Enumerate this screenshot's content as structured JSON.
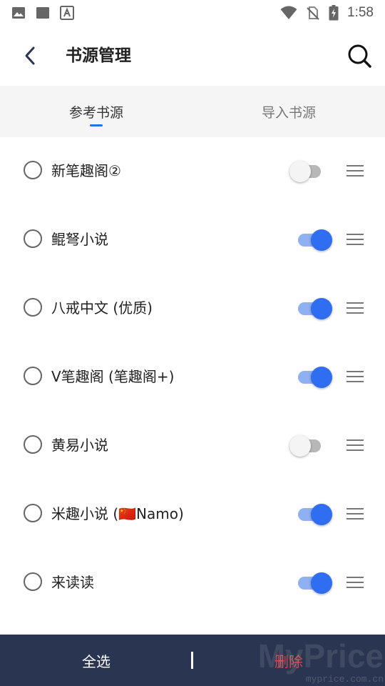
{
  "status_bar": {
    "time": "1:58",
    "left_icons": [
      "image-icon",
      "square-icon",
      "font-a-icon"
    ],
    "right_icons": [
      "wifi-icon",
      "no-sim-icon",
      "battery-charging-icon"
    ]
  },
  "header": {
    "title": "书源管理",
    "back_icon": "back-arrow-icon",
    "search_icon": "search-icon"
  },
  "tabs": [
    {
      "label": "参考书源",
      "active": true
    },
    {
      "label": "导入书源",
      "active": false
    }
  ],
  "sources": [
    {
      "name": "新笔趣阁②",
      "enabled": false
    },
    {
      "name": "鲲弩小说",
      "enabled": true
    },
    {
      "name": "八戒中文 (优质)",
      "enabled": true
    },
    {
      "name": "V笔趣阁 (笔趣阁+)",
      "enabled": true
    },
    {
      "name": "黄易小说",
      "enabled": false
    },
    {
      "name": "米趣小说 (🇨🇳Namo)",
      "enabled": true
    },
    {
      "name": "来读读",
      "enabled": true
    }
  ],
  "bottom_bar": {
    "select_all_label": "全选",
    "delete_label": "删除"
  },
  "watermark": {
    "brand": "MyPrice",
    "site": "myprice.com.cn"
  },
  "colors": {
    "accent": "#2f6ef0",
    "bottom_bar_bg": "#2a3551",
    "delete_text": "#d24a4a",
    "tab_bg": "#f5f5f5"
  }
}
